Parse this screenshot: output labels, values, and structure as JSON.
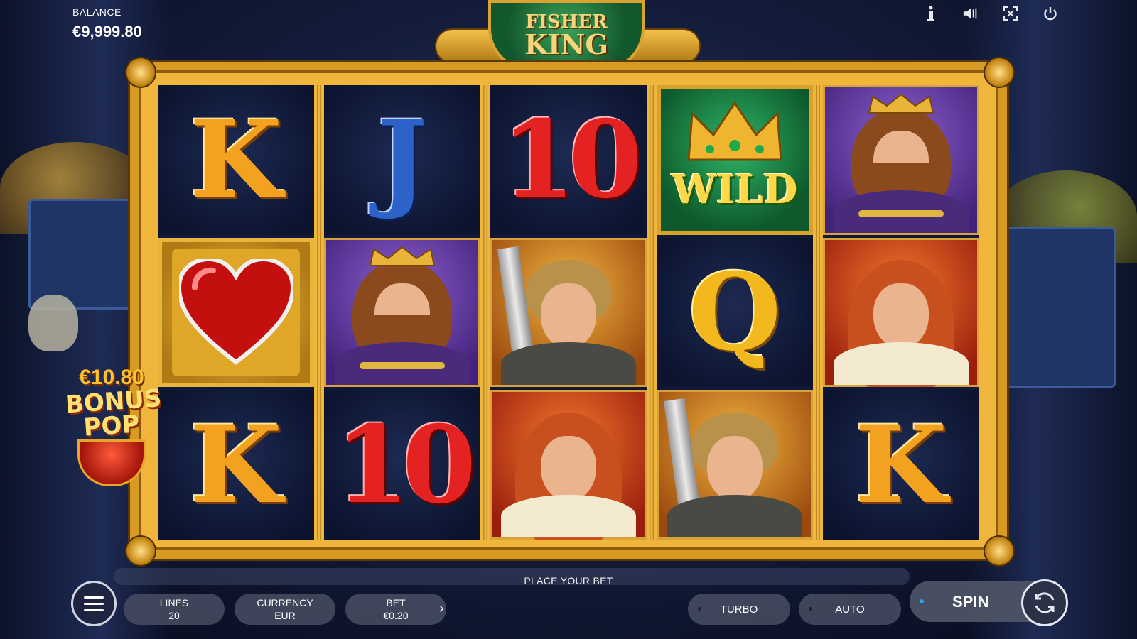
{
  "hud": {
    "balance_label": "BALANCE",
    "balance_value": "€9,999.80",
    "icons": [
      "info-icon",
      "sound-icon",
      "fullscreen-icon",
      "power-icon"
    ]
  },
  "logo": {
    "line1": "FISHER",
    "line2": "KING"
  },
  "reels": [
    [
      "K",
      "heart",
      "K"
    ],
    [
      "J",
      "king",
      "10"
    ],
    [
      "10",
      "knight",
      "maiden"
    ],
    [
      "wild",
      "Q",
      "knight"
    ],
    [
      "king",
      "maiden",
      "K"
    ]
  ],
  "wild_label": "WILD",
  "bonus": {
    "amount": "€10.80",
    "line1": "BONUS",
    "line2": "POP"
  },
  "controls": {
    "place_bet": "PLACE YOUR BET",
    "lines_label": "LINES",
    "lines_value": "20",
    "currency_label": "CURRENCY",
    "currency_value": "EUR",
    "bet_label": "BET",
    "bet_value": "€0.20",
    "turbo": "TURBO",
    "auto": "AUTO",
    "spin": "SPIN"
  },
  "colors": {
    "frame_gold": "#d79b24",
    "spin_indicator": "#2aa7e8",
    "card_k": "#f2a21e",
    "card_j": "#2d63c8",
    "card_10": "#e52222",
    "card_q": "#f2b81e"
  }
}
